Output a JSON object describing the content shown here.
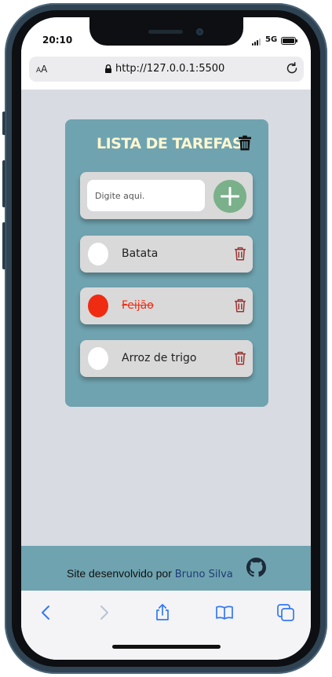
{
  "status_bar": {
    "time": "20:10",
    "network": "5G"
  },
  "browser": {
    "text_size_label_small": "A",
    "text_size_label_big": "A",
    "url": "http://127.0.0.1:5500"
  },
  "app": {
    "title": "LISTA DE TAREFAS",
    "input": {
      "placeholder": "Digite aqui.",
      "value": ""
    },
    "tasks": [
      {
        "text": "Batata",
        "done": false
      },
      {
        "text": "Feijão",
        "done": true
      },
      {
        "text": "Arroz de trigo",
        "done": false
      }
    ]
  },
  "footer": {
    "text": "Site desenvolvido por",
    "author_link": "Bruno Silva"
  },
  "icons": {
    "clear": "trash-icon",
    "add": "plus-icon",
    "delete": "trash-outline-icon",
    "github": "github-icon",
    "back": "chevron-left-icon",
    "forward": "chevron-right-icon",
    "share": "share-icon",
    "bookmarks": "book-icon",
    "tabs": "tabs-icon"
  },
  "colors": {
    "card": "#6fa3b0",
    "title": "#fdf6cf",
    "add_button": "#7ab08a",
    "done": "#ef2c12",
    "delete_icon": "#9b3434",
    "page_bg": "#d8dbe2"
  }
}
